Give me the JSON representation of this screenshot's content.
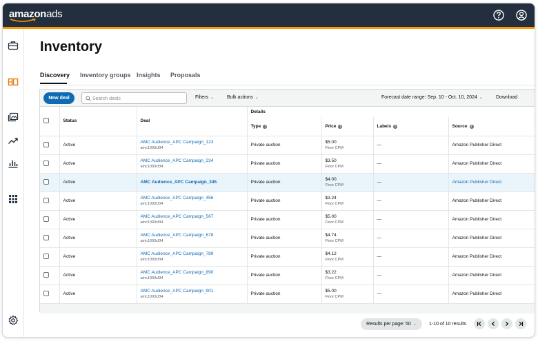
{
  "header": {
    "logo_main": "amazon",
    "logo_suffix": "ads"
  },
  "page": {
    "title": "Inventory"
  },
  "tabs": [
    {
      "label": "Discovery",
      "active": true
    },
    {
      "label": "Inventory groups",
      "active": false
    },
    {
      "label": "Insights",
      "active": false
    },
    {
      "label": "Proposals",
      "active": false
    }
  ],
  "toolbar": {
    "new_deal": "New deal",
    "search_placeholder": "Search deals",
    "filters": "Filters",
    "bulk_actions": "Bulk actions",
    "forecast": "Forecast date range: Sep. 10 - Oct. 10, 2024",
    "download": "Download"
  },
  "table": {
    "group_header": "Details",
    "columns": {
      "status": "Status",
      "deal": "Deal",
      "type": "Type",
      "price": "Price",
      "labels": "Labels",
      "source": "Source"
    },
    "rows": [
      {
        "status": "Active",
        "deal": "AMC Audience_APC Campaign_123",
        "deal_id": "amc1093cf34",
        "type": "Private auction",
        "price": "$5.00",
        "price_sub": "Floor CPM",
        "labels": "—",
        "source": "Amazon Publisher Direct",
        "highlight": false
      },
      {
        "status": "Active",
        "deal": "AMC Audience_APC Campaign_234",
        "deal_id": "amc1093cf34",
        "type": "Private auction",
        "price": "$3.50",
        "price_sub": "Floor CPM",
        "labels": "—",
        "source": "Amazon Publisher Direct",
        "highlight": false
      },
      {
        "status": "Active",
        "deal": "AMC Audience_APC Campaign_345",
        "deal_id": "",
        "type": "Private auction",
        "price": "$4.00",
        "price_sub": "Floor CPM",
        "labels": "—",
        "source": "Amazon Publisher Direct",
        "highlight": true
      },
      {
        "status": "Active",
        "deal": "AMC Audience_APC Campaign_456",
        "deal_id": "amc1093cf34",
        "type": "Private auction",
        "price": "$3.24",
        "price_sub": "Floor CPM",
        "labels": "—",
        "source": "Amazon Publisher Direct",
        "highlight": false
      },
      {
        "status": "Active",
        "deal": "AMC Audience_APC Campaign_567",
        "deal_id": "amc1093cf34",
        "type": "Private auction",
        "price": "$5.00",
        "price_sub": "Floor CPM",
        "labels": "—",
        "source": "Amazon Publisher Direct",
        "highlight": false
      },
      {
        "status": "Active",
        "deal": "AMC Audience_APC Campaign_678",
        "deal_id": "amc1093cf34",
        "type": "Private auction",
        "price": "$4.74",
        "price_sub": "Floor CPM",
        "labels": "—",
        "source": "Amazon Publisher Direct",
        "highlight": false
      },
      {
        "status": "Active",
        "deal": "AMC Audience_APC Campaign_789",
        "deal_id": "amc1093cf34",
        "type": "Private auction",
        "price": "$4.12",
        "price_sub": "Floor CPM",
        "labels": "—",
        "source": "Amazon Publisher Direct",
        "highlight": false
      },
      {
        "status": "Active",
        "deal": "AMC Audience_APC Campaign_890",
        "deal_id": "amc1093cf34",
        "type": "Private auction",
        "price": "$3.22",
        "price_sub": "Floor CPM",
        "labels": "—",
        "source": "Amazon Publisher Direct",
        "highlight": false
      },
      {
        "status": "Active",
        "deal": "AMC Audience_APC Campaign_901",
        "deal_id": "amc1093cf34",
        "type": "Private auction",
        "price": "$5.00",
        "price_sub": "Floor CPM",
        "labels": "—",
        "source": "Amazon Publisher Direct",
        "highlight": false
      }
    ]
  },
  "pagination": {
    "per_page": "Results per page: 50",
    "results": "1-10 of 10 results"
  },
  "colors": {
    "topbar": "#232f3e",
    "accent": "#ff9900",
    "link": "#0f6ab4",
    "highlight_row": "#eaf4fb",
    "nav_active": "#e47911"
  },
  "icons": {
    "help": "help-circle-icon",
    "account": "account-icon",
    "nav": [
      "briefcase-icon",
      "inventory-icon",
      "media-icon",
      "trending-icon",
      "bar-chart-icon",
      "apps-grid-icon",
      "settings-icon"
    ]
  }
}
